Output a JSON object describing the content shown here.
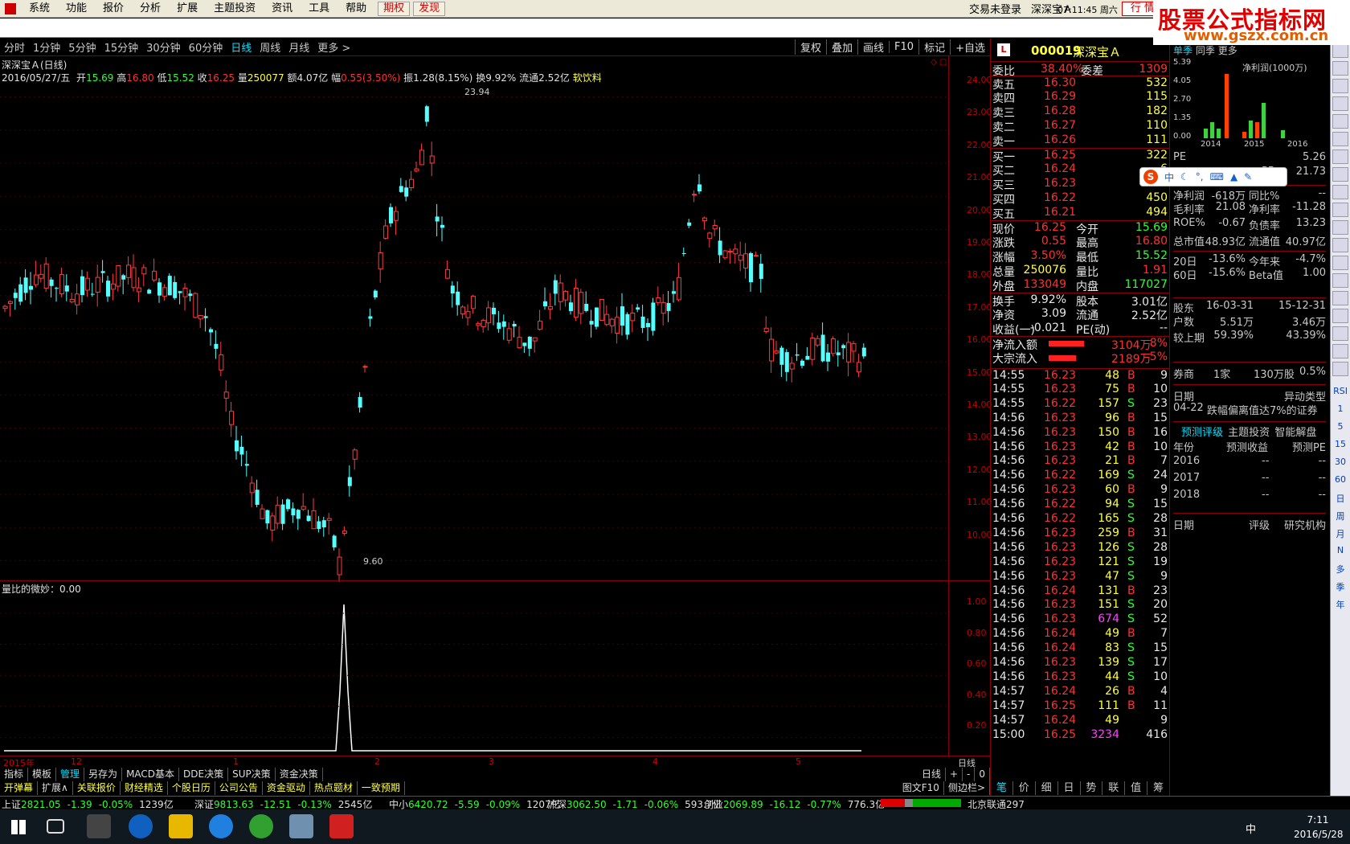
{
  "menu": {
    "items": [
      "系统",
      "功能",
      "报价",
      "分析",
      "扩展",
      "主题投资",
      "资讯",
      "工具",
      "帮助"
    ],
    "qiquan": "期权",
    "faxian": "发现",
    "login": "交易未登录",
    "stock": "深深宝Ａ",
    "time": "07:11:45 周六",
    "trade": "行 情"
  },
  "brand": {
    "line1": "股票公式指标网",
    "line2": "www.gszx.com.cn"
  },
  "periods": {
    "items": [
      "分时",
      "1分钟",
      "5分钟",
      "15分钟",
      "30分钟",
      "60分钟",
      "日线",
      "周线",
      "月线",
      "更多 >"
    ],
    "active": "日线",
    "tools": [
      "复权",
      "叠加",
      "画线",
      "F10",
      "标记",
      "+自选"
    ]
  },
  "chart": {
    "title": "深深宝Ａ(日线)",
    "date": "2016/05/27/五",
    "open_l": "开",
    "open": "15.69",
    "high_l": "高",
    "high": "16.80",
    "low_l": "低",
    "low": "15.52",
    "close_l": "收",
    "close": "16.25",
    "vol_l": "量",
    "vol": "250077",
    "amt_l": "额",
    "amt": "4.07亿",
    "chg_l": "幅",
    "chg": "0.55(3.50%)",
    "amp_l": "振",
    "amp": "1.28(8.15%)",
    "turn_l": "换",
    "turn": "9.92%",
    "float_l": "流通",
    "float": "2.52亿",
    "industry": "软饮料",
    "peak": "23.94",
    "trough": "9.60",
    "yticks": [
      "24.00",
      "23.00",
      "22.00",
      "21.00",
      "20.00",
      "19.00",
      "18.00",
      "17.00",
      "16.00",
      "15.00",
      "14.00",
      "13.00",
      "12.00",
      "11.00",
      "10.00"
    ],
    "sub_title": "量比的微妙：0.00",
    "sub_yticks": [
      "1.00",
      "0.80",
      "0.60",
      "0.40",
      "0.20"
    ],
    "xaxis": [
      "2015年",
      "12",
      "1",
      "2",
      "3",
      "4",
      "5"
    ],
    "xright": "日线"
  },
  "chart_data": {
    "type": "candlestick",
    "ylim": [
      9.5,
      24.5
    ]
  },
  "bottom_tabs": {
    "row1": [
      "指标",
      "模板",
      "管理",
      "另存为",
      "MACD基本",
      "DDE决策",
      "SUP决策",
      "资金决策"
    ],
    "row2": [
      "开弹幕",
      "扩展∧",
      "关联报价",
      "财经精选",
      "个股日历",
      "公司公告",
      "资金驱动",
      "热点题材",
      "一致预期"
    ],
    "right1": [
      "日线",
      "+",
      "-",
      "0"
    ],
    "right2": [
      "图文F10",
      "侧边栏>"
    ]
  },
  "quote": {
    "code": "000019",
    "name": "深深宝Ａ",
    "wb_l": "委比",
    "wb": "38.40%",
    "wc_l": "委差",
    "wc": "1309",
    "sells": [
      {
        "l": "卖五",
        "p": "16.30",
        "v": "532"
      },
      {
        "l": "卖四",
        "p": "16.29",
        "v": "115"
      },
      {
        "l": "卖三",
        "p": "16.28",
        "v": "182"
      },
      {
        "l": "卖二",
        "p": "16.27",
        "v": "110"
      },
      {
        "l": "卖一",
        "p": "16.26",
        "v": "111"
      }
    ],
    "buys": [
      {
        "l": "买一",
        "p": "16.25",
        "v": "322"
      },
      {
        "l": "买二",
        "p": "16.24",
        "v": "6"
      },
      {
        "l": "买三",
        "p": "16.23",
        "v": "310"
      },
      {
        "l": "买四",
        "p": "16.22",
        "v": "450"
      },
      {
        "l": "买五",
        "p": "16.21",
        "v": "494"
      }
    ],
    "stats": [
      [
        "现价",
        "16.25",
        "今开",
        "15.69"
      ],
      [
        "涨跌",
        "0.55",
        "最高",
        "16.80"
      ],
      [
        "涨幅",
        "3.50%",
        "最低",
        "15.52"
      ],
      [
        "总量",
        "250076",
        "量比",
        "1.91"
      ],
      [
        "外盘",
        "133049",
        "内盘",
        "117027"
      ]
    ],
    "stats2": [
      [
        "换手",
        "9.92%",
        "股本",
        "3.01亿"
      ],
      [
        "净资",
        "3.09",
        "流通",
        "2.52亿"
      ],
      [
        "收益(一)",
        "-0.021",
        "PE(动)",
        "--"
      ]
    ],
    "flow": [
      {
        "l": "净流入额",
        "v": "3104万",
        "p": "8%"
      },
      {
        "l": "大宗流入",
        "v": "2189万",
        "p": "5%"
      }
    ],
    "ticks": [
      [
        "14:55",
        "16.23",
        "48",
        "B",
        "9"
      ],
      [
        "14:55",
        "16.23",
        "75",
        "B",
        "10"
      ],
      [
        "14:55",
        "16.22",
        "157",
        "S",
        "23"
      ],
      [
        "14:56",
        "16.23",
        "96",
        "B",
        "15"
      ],
      [
        "14:56",
        "16.23",
        "150",
        "B",
        "16"
      ],
      [
        "14:56",
        "16.23",
        "42",
        "B",
        "10"
      ],
      [
        "14:56",
        "16.23",
        "21",
        "B",
        "7"
      ],
      [
        "14:56",
        "16.22",
        "169",
        "S",
        "24"
      ],
      [
        "14:56",
        "16.23",
        "60",
        "B",
        "9"
      ],
      [
        "14:56",
        "16.22",
        "94",
        "S",
        "15"
      ],
      [
        "14:56",
        "16.22",
        "165",
        "S",
        "28"
      ],
      [
        "14:56",
        "16.23",
        "259",
        "B",
        "31"
      ],
      [
        "14:56",
        "16.23",
        "126",
        "S",
        "28"
      ],
      [
        "14:56",
        "16.23",
        "121",
        "S",
        "19"
      ],
      [
        "14:56",
        "16.23",
        "47",
        "S",
        "9"
      ],
      [
        "14:56",
        "16.24",
        "131",
        "B",
        "23"
      ],
      [
        "14:56",
        "16.23",
        "151",
        "S",
        "20"
      ],
      [
        "14:56",
        "16.23",
        "674",
        "S",
        "52"
      ],
      [
        "14:56",
        "16.24",
        "49",
        "B",
        "7"
      ],
      [
        "14:56",
        "16.24",
        "83",
        "S",
        "15"
      ],
      [
        "14:56",
        "16.23",
        "139",
        "S",
        "17"
      ],
      [
        "14:56",
        "16.23",
        "44",
        "S",
        "10"
      ],
      [
        "14:57",
        "16.24",
        "26",
        "B",
        "4"
      ],
      [
        "14:57",
        "16.25",
        "111",
        "B",
        "11"
      ],
      [
        "14:57",
        "16.24",
        "49",
        "",
        "9"
      ],
      [
        "15:00",
        "16.25",
        "3234",
        "",
        "416"
      ]
    ],
    "bottom_tabs": [
      "笔",
      "价",
      "细",
      "日",
      "势",
      "联",
      "值",
      "筹"
    ]
  },
  "f10": {
    "tabs": [
      "单季",
      "同季",
      "更多"
    ],
    "chart_title": "净利润(1000万)",
    "yt": [
      "5.39",
      "4.05",
      "2.70",
      "1.35",
      "0.00"
    ],
    "years": [
      "2014",
      "2015",
      "2016"
    ],
    "pe_l": "PE",
    "pe_v": "5.26",
    "pb_l": "PB",
    "pb_v": "21.73",
    "rows1": [
      [
        "净利润",
        "-618万",
        "同比%",
        "--"
      ],
      [
        "毛利率",
        "21.08",
        "净利率",
        "-11.28"
      ],
      [
        "ROE%",
        "-0.67",
        "负债率",
        "13.23"
      ],
      [
        "总市值",
        "48.93亿",
        "流通值",
        "40.97亿"
      ]
    ],
    "rows2": [
      [
        "20日",
        "-13.6%",
        "今年来",
        "-4.7%"
      ],
      [
        "60日",
        "-15.6%",
        "Beta值",
        "1.00"
      ]
    ],
    "holders": [
      [
        "股东",
        "16-03-31",
        "15-12-31"
      ],
      [
        "户数",
        "5.51万",
        "3.46万"
      ],
      [
        "较上期",
        "59.39%",
        "43.39%"
      ]
    ],
    "margin": [
      "券商",
      "1家",
      "130万股",
      "0.5%"
    ],
    "event_h": [
      "日期",
      "异动类型"
    ],
    "event": [
      "04-22",
      "跌幅偏离值达7%的证券"
    ],
    "rate_tabs": [
      "预测评级",
      "主题投资",
      "智能解盘"
    ],
    "rate_h": [
      "年份",
      "预测收益",
      "预测PE"
    ],
    "rate_rows": [
      [
        "2016",
        "--",
        "--"
      ],
      [
        "2017",
        "--",
        "--"
      ],
      [
        "2018",
        "--",
        "--"
      ]
    ],
    "rank_h": [
      "日期",
      "评级",
      "研究机构"
    ]
  },
  "sidebar": [
    "RSI",
    "1",
    "5",
    "15",
    "30",
    "60",
    "日",
    "周",
    "月",
    "N",
    "多",
    "季",
    "年"
  ],
  "status": {
    "items": [
      [
        "上证",
        "2821.05",
        "-1.39",
        "-0.05%",
        "1239亿"
      ],
      [
        "深证",
        "9813.63",
        "-12.51",
        "-0.13%",
        "2545亿"
      ],
      [
        "中小",
        "6420.72",
        "-5.59",
        "-0.09%",
        "1207亿"
      ],
      [
        "沪深",
        "3062.50",
        "-1.71",
        "-0.06%",
        "593.7亿"
      ],
      [
        "创业",
        "2069.89",
        "-16.12",
        "-0.77%",
        "776.3亿"
      ]
    ],
    "net": "北京联通297"
  },
  "ime": {
    "label": "中"
  },
  "taskbar": {
    "time": "7:11",
    "date": "2016/5/28",
    "ime": "中"
  }
}
